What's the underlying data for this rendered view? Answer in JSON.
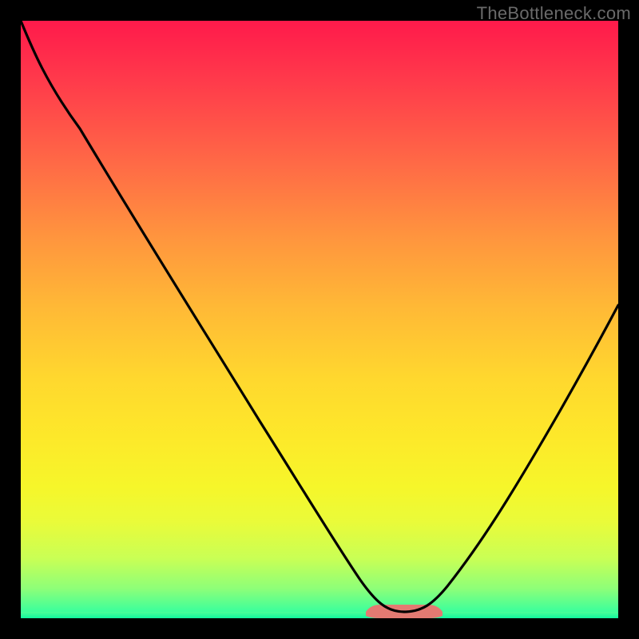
{
  "watermark": "TheBottleneck.com",
  "chart_data": {
    "type": "line",
    "title": "",
    "xlabel": "",
    "ylabel": "",
    "xlim": [
      0,
      100
    ],
    "ylim": [
      0,
      100
    ],
    "grid": false,
    "legend": false,
    "series": [
      {
        "name": "bottleneck-curve",
        "x": [
          0,
          10,
          20,
          30,
          40,
          50,
          55,
          60,
          63,
          67,
          70,
          75,
          80,
          90,
          100
        ],
        "y": [
          100,
          82,
          65,
          49,
          33,
          18,
          10,
          4,
          1,
          1,
          3,
          10,
          19,
          36,
          55
        ]
      }
    ],
    "annotations": [
      {
        "name": "optimal-range",
        "x_range": [
          58,
          70
        ],
        "y": 1,
        "color": "#e37a72"
      }
    ],
    "background_gradient": {
      "top": "#ff1a4b",
      "mid": "#ffd82e",
      "bottom": "#12ffa6"
    }
  }
}
